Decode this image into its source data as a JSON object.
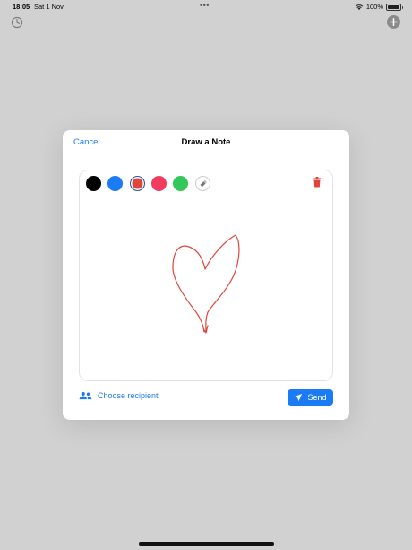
{
  "status_bar": {
    "time": "18:05",
    "date": "Sat 1 Nov",
    "dots": "•••",
    "battery": "100%"
  },
  "modal": {
    "cancel_label": "Cancel",
    "title": "Draw a Note"
  },
  "palette": {
    "colors": [
      "#000000",
      "#1a7bf5",
      "#e0453a",
      "#f23c5e",
      "#34c759"
    ],
    "selected_index": 2
  },
  "footer": {
    "recipient_label": "Choose recipient",
    "send_label": "Send"
  },
  "drawing_color": "#e0453a",
  "accent_color": "#1a7bf5"
}
